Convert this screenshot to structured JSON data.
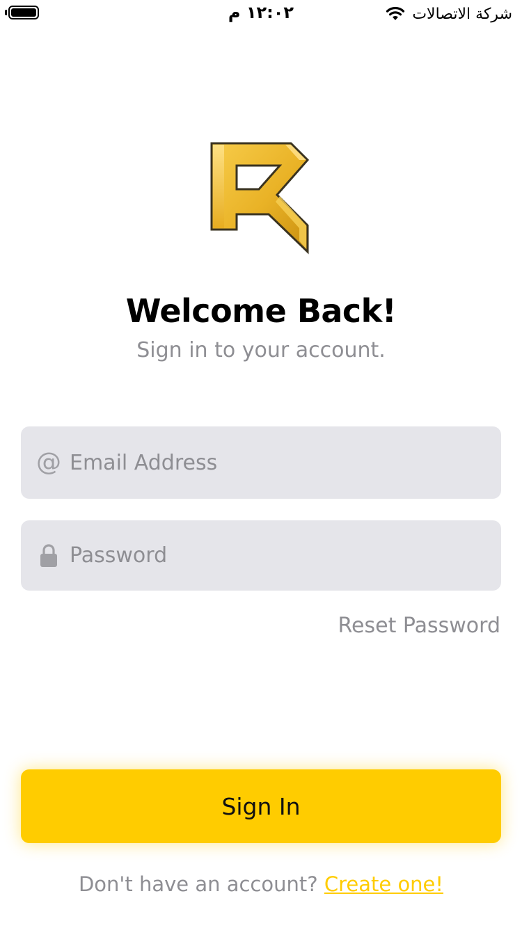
{
  "status_bar": {
    "time": "١٢:٠٢ م",
    "carrier": "شركة الاتصالات",
    "icons": [
      "battery-icon",
      "wifi-icon"
    ]
  },
  "header": {
    "logo": "r-logo",
    "title": "Welcome Back!",
    "subtitle": "Sign in to your account."
  },
  "form": {
    "email": {
      "icon": "at-icon",
      "icon_glyph": "@",
      "placeholder": "Email Address",
      "value": ""
    },
    "password": {
      "icon": "lock-icon",
      "placeholder": "Password",
      "value": ""
    },
    "reset_label": "Reset Password"
  },
  "actions": {
    "sign_in_label": "Sign In"
  },
  "footer": {
    "prompt": "Don't have an account?",
    "link_label": "Create one!"
  },
  "colors": {
    "accent": "#ffcc00",
    "field_bg": "#e5e5ea",
    "muted_text": "#8e8e93",
    "title_text": "#000000"
  }
}
